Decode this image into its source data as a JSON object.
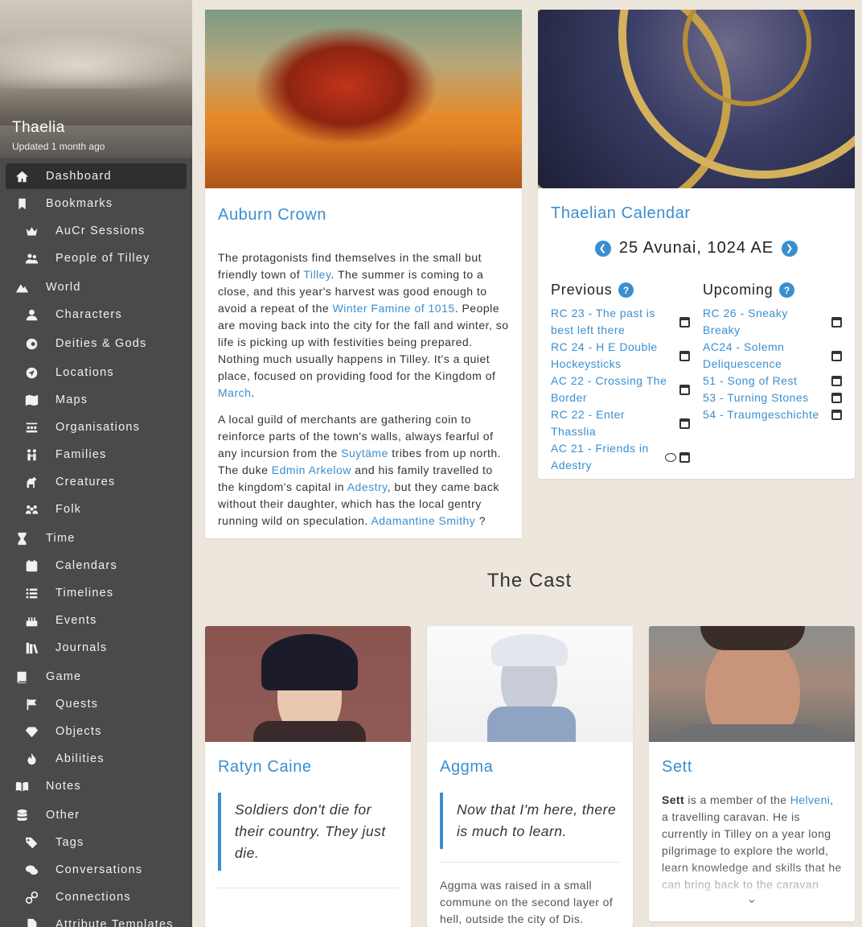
{
  "campaign": {
    "name": "Thaelia",
    "updated": "Updated 1 month ago"
  },
  "nav": [
    {
      "label": "Dashboard",
      "icon": "home-icon",
      "level": "top",
      "active": true
    },
    {
      "label": "Bookmarks",
      "icon": "bookmark-icon",
      "level": "top"
    },
    {
      "label": "AuCr Sessions",
      "icon": "crown-icon",
      "level": "sub"
    },
    {
      "label": "People of Tilley",
      "icon": "users-icon",
      "level": "sub"
    },
    {
      "label": "World",
      "icon": "mountain-icon",
      "level": "top"
    },
    {
      "label": "Characters",
      "icon": "user-icon",
      "level": "sub"
    },
    {
      "label": "Deities & Gods",
      "icon": "deity-icon",
      "level": "sub"
    },
    {
      "label": "Locations",
      "icon": "location-arrow-icon",
      "level": "sub"
    },
    {
      "label": "Maps",
      "icon": "map-icon",
      "level": "sub"
    },
    {
      "label": "Organisations",
      "icon": "organisation-icon",
      "level": "sub"
    },
    {
      "label": "Families",
      "icon": "family-icon",
      "level": "sub"
    },
    {
      "label": "Creatures",
      "icon": "horse-icon",
      "level": "sub"
    },
    {
      "label": "Folk",
      "icon": "folk-icon",
      "level": "sub"
    },
    {
      "label": "Time",
      "icon": "hourglass-icon",
      "level": "top"
    },
    {
      "label": "Calendars",
      "icon": "calendar-icon",
      "level": "sub"
    },
    {
      "label": "Timelines",
      "icon": "list-icon",
      "level": "sub"
    },
    {
      "label": "Events",
      "icon": "cake-icon",
      "level": "sub"
    },
    {
      "label": "Journals",
      "icon": "books-icon",
      "level": "sub"
    },
    {
      "label": "Game",
      "icon": "book-icon",
      "level": "top"
    },
    {
      "label": "Quests",
      "icon": "flag-icon",
      "level": "sub"
    },
    {
      "label": "Objects",
      "icon": "gem-icon",
      "level": "sub"
    },
    {
      "label": "Abilities",
      "icon": "fire-icon",
      "level": "sub"
    },
    {
      "label": "Notes",
      "icon": "open-book-icon",
      "level": "top"
    },
    {
      "label": "Other",
      "icon": "database-icon",
      "level": "top"
    },
    {
      "label": "Tags",
      "icon": "tags-icon",
      "level": "sub"
    },
    {
      "label": "Conversations",
      "icon": "comments-icon",
      "level": "sub"
    },
    {
      "label": "Connections",
      "icon": "link-icon",
      "level": "sub"
    },
    {
      "label": "Attribute Templates",
      "icon": "file-icon",
      "level": "sub"
    }
  ],
  "auburn": {
    "title": "Auburn Crown",
    "p1": [
      {
        "t": "The protagonists find themselves in the small but friendly town of "
      },
      {
        "t": "Tilley",
        "link": true
      },
      {
        "t": ". The summer is coming to a close, and this year's harvest was good enough to avoid a repeat of the "
      },
      {
        "t": "Winter Famine of 1015",
        "link": true
      },
      {
        "t": ". People are moving back into the city for the fall and winter, so life is picking up with festivities being prepared. Nothing much usually happens in Tilley. It's a quiet place, focused on providing food for the Kingdom of "
      },
      {
        "t": "March",
        "link": true
      },
      {
        "t": "."
      }
    ],
    "p2": [
      {
        "t": "A local guild of merchants are gathering coin to reinforce parts of the town's walls, always fearful of any incursion from the "
      },
      {
        "t": "Suytäme",
        "link": true
      },
      {
        "t": " tribes from up north. The duke "
      },
      {
        "t": "Edmin Arkelow",
        "link": true
      },
      {
        "t": " and his family travelled to the kingdom's capital in "
      },
      {
        "t": "Adestry",
        "link": true
      },
      {
        "t": ", but they came back without their daughter, which has the local gentry running wild on speculation. "
      },
      {
        "t": "Adamantine Smithy",
        "link": true
      },
      {
        "t": " ?"
      }
    ]
  },
  "calendar": {
    "title": "Thaelian Calendar",
    "date": "25 Avunai, 1024 AE",
    "previous_label": "Previous",
    "upcoming_label": "Upcoming",
    "previous": [
      {
        "name": "RC 23 - The past is best left there"
      },
      {
        "name": "RC 24 - H E Double Hockeysticks"
      },
      {
        "name": "AC 22 - Crossing The Border"
      },
      {
        "name": "RC 22 - Enter Thasslia"
      },
      {
        "name": "AC 21 - Friends in Adestry",
        "chat": true
      }
    ],
    "upcoming": [
      {
        "name": "RC 26 - Sneaky Breaky"
      },
      {
        "name": "AC24 - Solemn Deliquescence"
      },
      {
        "name": "51 - Song of Rest"
      },
      {
        "name": "53 - Turning Stones"
      },
      {
        "name": "54 - Traumgeschichte"
      }
    ]
  },
  "cast": {
    "title": "The Cast",
    "ratyn": {
      "name": "Ratyn Caine",
      "quote": "Soldiers don't die for their country. They just die."
    },
    "aggma": {
      "name": "Aggma",
      "quote": "Now that I'm here, there is much to learn.",
      "text": "Aggma was raised in a small commune on the second layer of hell, outside the city of Dis."
    },
    "sett": {
      "name": "Sett",
      "bold": "Sett",
      "t1": " is a member of the ",
      "link": "Helveni",
      "t2": ", a travelling caravan. He is currently in Tilley on a year long pilgrimage to explore the world, learn knowledge and skills that he can bring back to the caravan"
    }
  },
  "colors": {
    "accent": "#3a8fd0",
    "sidebar": "#4a4a4a",
    "background": "#ece6dc"
  }
}
